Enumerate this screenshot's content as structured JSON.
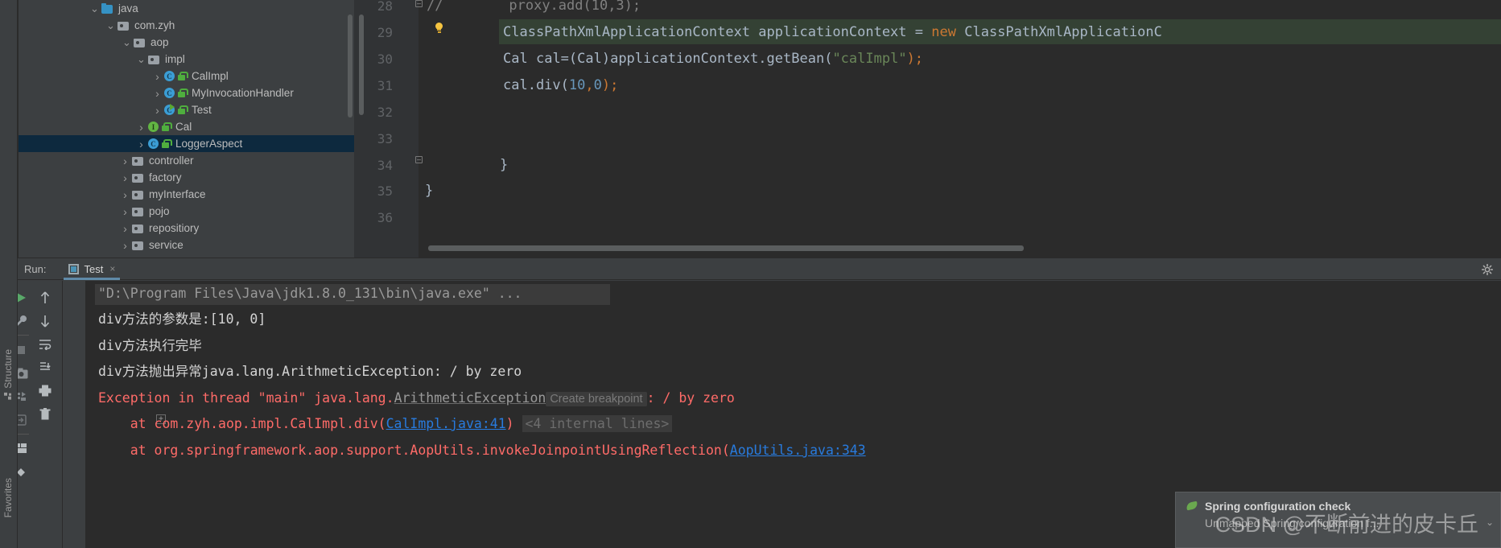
{
  "left_tool_strip": {
    "tabs": [
      {
        "label": "Structure",
        "icon": "structure-icon"
      },
      {
        "label": "Favorites",
        "icon": "favorites-icon"
      }
    ]
  },
  "project_tree": {
    "items": [
      {
        "label": "java",
        "indent": 88,
        "twisty": "v",
        "icon": "folder-source-blue",
        "selected": false
      },
      {
        "label": "com.zyh",
        "indent": 108,
        "twisty": "v",
        "icon": "folder-package",
        "selected": false
      },
      {
        "label": "aop",
        "indent": 128,
        "twisty": "v",
        "icon": "folder-package",
        "selected": false
      },
      {
        "label": "impl",
        "indent": 146,
        "twisty": "v",
        "icon": "folder-package",
        "selected": false
      },
      {
        "label": "CalImpl",
        "indent": 166,
        "twisty": ">",
        "icon": "java-class",
        "selected": false
      },
      {
        "label": "MyInvocationHandler",
        "indent": 166,
        "twisty": ">",
        "icon": "java-class",
        "selected": false
      },
      {
        "label": "Test",
        "indent": 166,
        "twisty": ">",
        "icon": "java-class-runnable",
        "selected": false
      },
      {
        "label": "Cal",
        "indent": 146,
        "twisty": ">",
        "icon": "java-interface",
        "selected": false
      },
      {
        "label": "LoggerAspect",
        "indent": 146,
        "twisty": ">",
        "icon": "java-class",
        "selected": true
      },
      {
        "label": "controller",
        "indent": 126,
        "twisty": ">",
        "icon": "folder-package",
        "selected": false
      },
      {
        "label": "factory",
        "indent": 126,
        "twisty": ">",
        "icon": "folder-package",
        "selected": false
      },
      {
        "label": "myInterface",
        "indent": 126,
        "twisty": ">",
        "icon": "folder-package",
        "selected": false
      },
      {
        "label": "pojo",
        "indent": 126,
        "twisty": ">",
        "icon": "folder-package",
        "selected": false
      },
      {
        "label": "repositiory",
        "indent": 126,
        "twisty": ">",
        "icon": "folder-package",
        "selected": false
      },
      {
        "label": "service",
        "indent": 126,
        "twisty": ">",
        "icon": "folder-package",
        "selected": false
      }
    ]
  },
  "editor": {
    "lines": [
      {
        "number": "28",
        "text": "//        proxy.add(10,3);"
      },
      {
        "number": "29",
        "text": "        ClassPathXmlApplicationContext applicationContext = new ClassPathXmlApplicationC"
      },
      {
        "number": "30",
        "text": "        Cal cal=(Cal)applicationContext.getBean(\"calImpl\");"
      },
      {
        "number": "31",
        "text": "        cal.div(10,0);"
      },
      {
        "number": "32",
        "text": ""
      },
      {
        "number": "33",
        "text": ""
      },
      {
        "number": "34",
        "text": "    }"
      },
      {
        "number": "35",
        "text": "}"
      },
      {
        "number": "36",
        "text": ""
      }
    ],
    "line29_tokens": {
      "type_name": "ClassPathXmlApplicationContext",
      "var_name": "applicationContext",
      "equals": "=",
      "new_keyword": "new",
      "ctor": "ClassPathXmlApplicationC"
    },
    "line30_tokens": {
      "type_name": "Cal",
      "var": "cal=(Cal)applicationContext.getBean(",
      "string": "\"calImpl\"",
      "tail": ");"
    },
    "line31_tokens": {
      "call": "cal.div(",
      "arg1": "10",
      "comma": ",",
      "arg2": "0",
      "tail": ");"
    },
    "line28_comment": "//",
    "line28_code": "proxy.add(10,3);",
    "intention_bulb": "lightbulb-icon"
  },
  "run_panel": {
    "run_label": "Run:",
    "tab_label": "Test",
    "tab_close": "×",
    "settings_icon": "gear-icon",
    "toolbar_icons": [
      "rerun-run-icon",
      "settings-wrench-icon",
      "stop-icon",
      "camera-icon",
      "restart-debug-icon",
      "export-icon",
      "layout-icon",
      "pin-icon",
      "scroll-up-icon",
      "scroll-down-icon",
      "soft-wrap-icon",
      "scroll-to-end-icon",
      "print-icon",
      "trash-icon"
    ]
  },
  "console": {
    "lines": [
      {
        "id": "cmd",
        "style": "grey-highlight",
        "text": "\"D:\\Program Files\\Java\\jdk1.8.0_131\\bin\\java.exe\" ..."
      },
      {
        "id": "out1",
        "style": "white",
        "text": "div方法的参数是:[10, 0]"
      },
      {
        "id": "out2",
        "style": "white",
        "text": "div方法执行完毕"
      },
      {
        "id": "out3",
        "style": "white",
        "text": "div方法抛出异常java.lang.ArithmeticException: / by zero"
      },
      {
        "id": "exc",
        "style": "red",
        "prefix": "Exception in thread \"main\" java.lang.",
        "fade": "ArithmeticException",
        "hint": "Create breakpoint",
        "suffix": ": / by zero"
      },
      {
        "id": "frame1",
        "style": "red",
        "prefix": "    at com.zyh.aop.impl.CalImpl.div(",
        "link": "CalImpl.java:41",
        "suffix": ")",
        "internal": "<4 internal lines>"
      },
      {
        "id": "frame2",
        "style": "red",
        "prefix": "    at org.springframework.aop.support.AopUtils.invokeJoinpointUsingReflection(",
        "link": "AopUtils.java:343"
      }
    ]
  },
  "notification": {
    "icon": "spring-leaf-icon",
    "title": "Spring configuration check",
    "body": "Unmapped Spring configuration f...",
    "chevron": "⌄"
  },
  "watermark": "CSDN @不断前进的皮卡丘",
  "colors": {
    "panel_bg": "#3c3f41",
    "editor_bg": "#2b2b2b",
    "selection_blue": "#0d293e",
    "error_red": "#ff6b68",
    "link_blue": "#287bde",
    "string_green": "#6a8759",
    "keyword_orange": "#cc7832",
    "number_blue": "#6897bb",
    "tab_underline": "#5f8aa8",
    "highlight_line": "#344134"
  }
}
